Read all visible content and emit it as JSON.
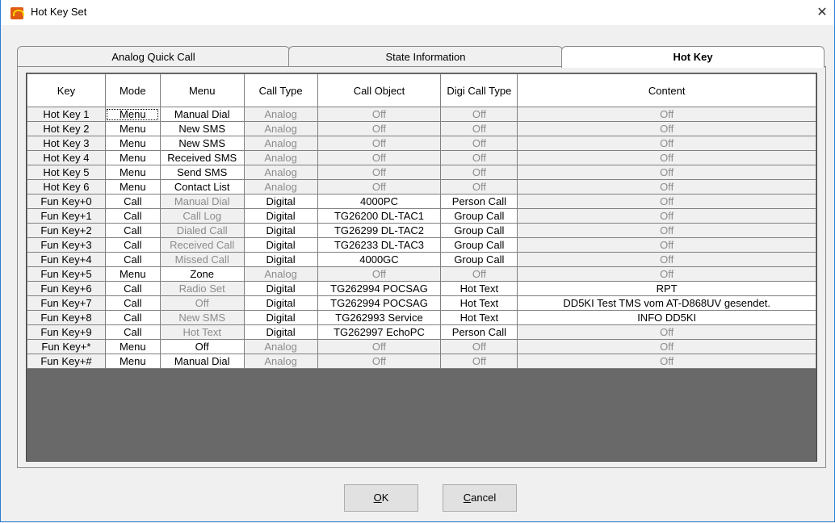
{
  "window": {
    "title": "Hot Key Set",
    "close_glyph": "✕"
  },
  "tabs": [
    {
      "label": "Analog Quick Call",
      "active": false
    },
    {
      "label": "State Information",
      "active": false
    },
    {
      "label": "Hot Key",
      "active": true
    }
  ],
  "table": {
    "columns": [
      "Key",
      "Mode",
      "Menu",
      "Call Type",
      "Call Object",
      "Digi Call Type",
      "Content"
    ],
    "rows": [
      {
        "key": "Hot Key 1",
        "mode": "Menu",
        "menu": "Manual Dial",
        "menu_active": true,
        "call_type": "Analog",
        "call_type_active": false,
        "call_object": "Off",
        "call_object_active": false,
        "digi_call_type": "Off",
        "digi_call_type_active": false,
        "content": "Off",
        "content_active": false
      },
      {
        "key": "Hot Key 2",
        "mode": "Menu",
        "menu": "New SMS",
        "menu_active": true,
        "call_type": "Analog",
        "call_type_active": false,
        "call_object": "Off",
        "call_object_active": false,
        "digi_call_type": "Off",
        "digi_call_type_active": false,
        "content": "Off",
        "content_active": false
      },
      {
        "key": "Hot Key 3",
        "mode": "Menu",
        "menu": "New SMS",
        "menu_active": true,
        "call_type": "Analog",
        "call_type_active": false,
        "call_object": "Off",
        "call_object_active": false,
        "digi_call_type": "Off",
        "digi_call_type_active": false,
        "content": "Off",
        "content_active": false
      },
      {
        "key": "Hot Key 4",
        "mode": "Menu",
        "menu": "Received SMS",
        "menu_active": true,
        "call_type": "Analog",
        "call_type_active": false,
        "call_object": "Off",
        "call_object_active": false,
        "digi_call_type": "Off",
        "digi_call_type_active": false,
        "content": "Off",
        "content_active": false
      },
      {
        "key": "Hot Key 5",
        "mode": "Menu",
        "menu": "Send SMS",
        "menu_active": true,
        "call_type": "Analog",
        "call_type_active": false,
        "call_object": "Off",
        "call_object_active": false,
        "digi_call_type": "Off",
        "digi_call_type_active": false,
        "content": "Off",
        "content_active": false
      },
      {
        "key": "Hot Key 6",
        "mode": "Menu",
        "menu": "Contact List",
        "menu_active": true,
        "call_type": "Analog",
        "call_type_active": false,
        "call_object": "Off",
        "call_object_active": false,
        "digi_call_type": "Off",
        "digi_call_type_active": false,
        "content": "Off",
        "content_active": false
      },
      {
        "key": "Fun Key+0",
        "mode": "Call",
        "menu": "Manual Dial",
        "menu_active": false,
        "call_type": "Digital",
        "call_type_active": true,
        "call_object": "4000PC",
        "call_object_active": true,
        "digi_call_type": "Person Call",
        "digi_call_type_active": true,
        "content": "Off",
        "content_active": false
      },
      {
        "key": "Fun Key+1",
        "mode": "Call",
        "menu": "Call Log",
        "menu_active": false,
        "call_type": "Digital",
        "call_type_active": true,
        "call_object": "TG26200 DL-TAC1",
        "call_object_active": true,
        "digi_call_type": "Group Call",
        "digi_call_type_active": true,
        "content": "Off",
        "content_active": false
      },
      {
        "key": "Fun Key+2",
        "mode": "Call",
        "menu": "Dialed Call",
        "menu_active": false,
        "call_type": "Digital",
        "call_type_active": true,
        "call_object": "TG26299 DL-TAC2",
        "call_object_active": true,
        "digi_call_type": "Group Call",
        "digi_call_type_active": true,
        "content": "Off",
        "content_active": false
      },
      {
        "key": "Fun Key+3",
        "mode": "Call",
        "menu": "Received Call",
        "menu_active": false,
        "call_type": "Digital",
        "call_type_active": true,
        "call_object": "TG26233 DL-TAC3",
        "call_object_active": true,
        "digi_call_type": "Group Call",
        "digi_call_type_active": true,
        "content": "Off",
        "content_active": false
      },
      {
        "key": "Fun Key+4",
        "mode": "Call",
        "menu": "Missed Call",
        "menu_active": false,
        "call_type": "Digital",
        "call_type_active": true,
        "call_object": "4000GC",
        "call_object_active": true,
        "digi_call_type": "Group Call",
        "digi_call_type_active": true,
        "content": "Off",
        "content_active": false
      },
      {
        "key": "Fun Key+5",
        "mode": "Menu",
        "menu": "Zone",
        "menu_active": true,
        "call_type": "Analog",
        "call_type_active": false,
        "call_object": "Off",
        "call_object_active": false,
        "digi_call_type": "Off",
        "digi_call_type_active": false,
        "content": "Off",
        "content_active": false
      },
      {
        "key": "Fun Key+6",
        "mode": "Call",
        "menu": "Radio Set",
        "menu_active": false,
        "call_type": "Digital",
        "call_type_active": true,
        "call_object": "TG262994 POCSAG",
        "call_object_active": true,
        "digi_call_type": "Hot Text",
        "digi_call_type_active": true,
        "content": "RPT",
        "content_active": true
      },
      {
        "key": "Fun Key+7",
        "mode": "Call",
        "menu": "Off",
        "menu_active": false,
        "call_type": "Digital",
        "call_type_active": true,
        "call_object": "TG262994 POCSAG",
        "call_object_active": true,
        "digi_call_type": "Hot Text",
        "digi_call_type_active": true,
        "content": "DD5KI Test TMS vom AT-D868UV gesendet.",
        "content_active": true
      },
      {
        "key": "Fun Key+8",
        "mode": "Call",
        "menu": "New SMS",
        "menu_active": false,
        "call_type": "Digital",
        "call_type_active": true,
        "call_object": "TG262993 Service",
        "call_object_active": true,
        "digi_call_type": "Hot Text",
        "digi_call_type_active": true,
        "content": "INFO DD5KI",
        "content_active": true
      },
      {
        "key": "Fun Key+9",
        "mode": "Call",
        "menu": "Hot Text",
        "menu_active": false,
        "call_type": "Digital",
        "call_type_active": true,
        "call_object": "TG262997 EchoPC",
        "call_object_active": true,
        "digi_call_type": "Person Call",
        "digi_call_type_active": true,
        "content": "Off",
        "content_active": false
      },
      {
        "key": "Fun Key+*",
        "mode": "Menu",
        "menu": "Off",
        "menu_active": true,
        "call_type": "Analog",
        "call_type_active": false,
        "call_object": "Off",
        "call_object_active": false,
        "digi_call_type": "Off",
        "digi_call_type_active": false,
        "content": "Off",
        "content_active": false
      },
      {
        "key": "Fun Key+#",
        "mode": "Menu",
        "menu": "Manual Dial",
        "menu_active": true,
        "call_type": "Analog",
        "call_type_active": false,
        "call_object": "Off",
        "call_object_active": false,
        "digi_call_type": "Off",
        "digi_call_type_active": false,
        "content": "Off",
        "content_active": false
      }
    ]
  },
  "buttons": {
    "ok": {
      "mnemonic": "O",
      "rest": "K"
    },
    "cancel": {
      "mnemonic": "C",
      "rest": "ancel"
    }
  },
  "colors": {
    "accent": "#2b7cd3",
    "disabled_text": "#8c8c8c",
    "grid_background": "#696969"
  }
}
